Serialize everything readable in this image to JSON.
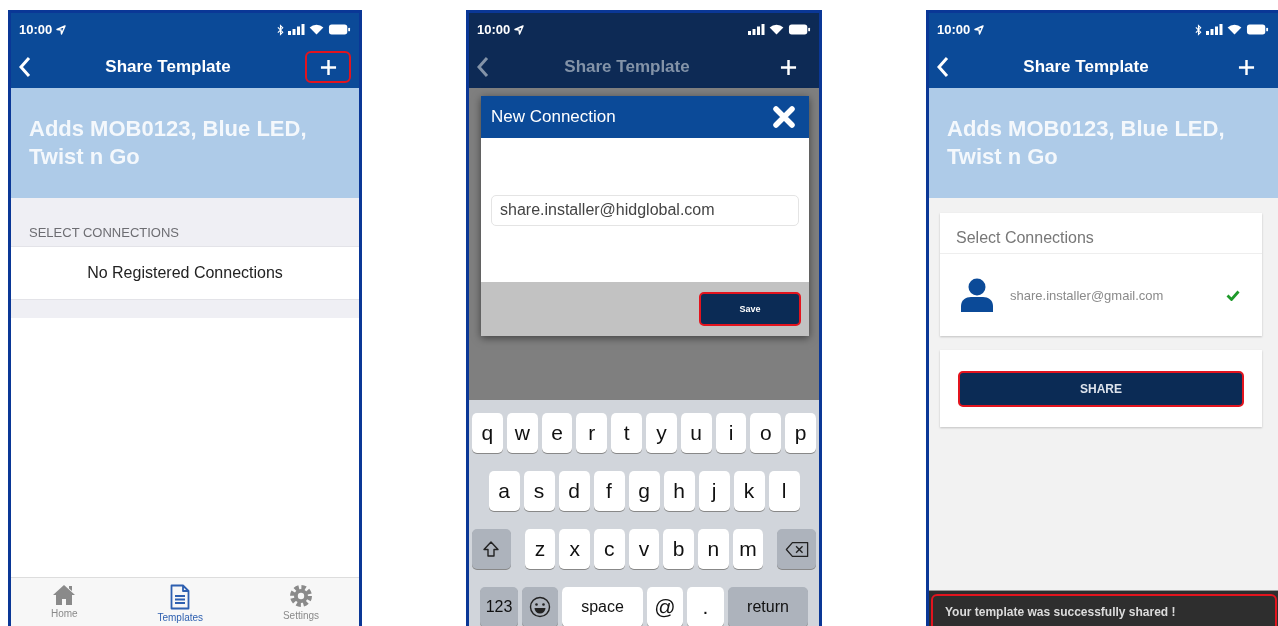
{
  "phones": [
    {
      "kind": "empty",
      "status_bar": {
        "time": "10:00",
        "bluetooth": true
      },
      "nav": {
        "title": "Share Template",
        "add_highlighted": true
      },
      "template_name": "Adds MOB0123, Blue LED, Twist n Go",
      "section_label": "SELECT CONNECTIONS",
      "empty_message": "No Registered Connections",
      "tabs": [
        {
          "kind": "home",
          "label": "Home",
          "selected": false
        },
        {
          "kind": "templates",
          "label": "Templates",
          "selected": true
        },
        {
          "kind": "settings",
          "label": "Settings",
          "selected": false
        }
      ]
    },
    {
      "kind": "dialog",
      "status_bar": {
        "time": "10:00",
        "bluetooth": false
      },
      "nav": {
        "title": "Share Template",
        "add_highlighted": false
      },
      "dialog": {
        "title": "New Connection",
        "value": "share.installer@hidglobal.com",
        "save_label": "Save",
        "save_highlighted": true
      },
      "keyboard": [
        [
          {
            "kind": "letter",
            "label": "q"
          },
          {
            "kind": "letter",
            "label": "w"
          },
          {
            "kind": "letter",
            "label": "e"
          },
          {
            "kind": "letter",
            "label": "r"
          },
          {
            "kind": "letter",
            "label": "t"
          },
          {
            "kind": "letter",
            "label": "y"
          },
          {
            "kind": "letter",
            "label": "u"
          },
          {
            "kind": "letter",
            "label": "i"
          },
          {
            "kind": "letter",
            "label": "o"
          },
          {
            "kind": "letter",
            "label": "p"
          }
        ],
        [
          {
            "kind": "letter",
            "label": "a"
          },
          {
            "kind": "letter",
            "label": "s"
          },
          {
            "kind": "letter",
            "label": "d"
          },
          {
            "kind": "letter",
            "label": "f"
          },
          {
            "kind": "letter",
            "label": "g"
          },
          {
            "kind": "letter",
            "label": "h"
          },
          {
            "kind": "letter",
            "label": "j"
          },
          {
            "kind": "letter",
            "label": "k"
          },
          {
            "kind": "letter",
            "label": "l"
          }
        ],
        [
          {
            "kind": "shift"
          },
          {
            "kind": "letter",
            "label": "z"
          },
          {
            "kind": "letter",
            "label": "x"
          },
          {
            "kind": "letter",
            "label": "c"
          },
          {
            "kind": "letter",
            "label": "v"
          },
          {
            "kind": "letter",
            "label": "b"
          },
          {
            "kind": "letter",
            "label": "n"
          },
          {
            "kind": "letter",
            "label": "m"
          },
          {
            "kind": "backspace"
          }
        ],
        [
          {
            "kind": "mode",
            "label": "123"
          },
          {
            "kind": "emoji"
          },
          {
            "kind": "space",
            "label": "space"
          },
          {
            "kind": "symbol",
            "label": "@"
          },
          {
            "kind": "dot",
            "label": "."
          },
          {
            "kind": "return",
            "label": "return"
          }
        ]
      ]
    },
    {
      "kind": "shared",
      "status_bar": {
        "time": "10:00",
        "bluetooth": true
      },
      "nav": {
        "title": "Share Template",
        "add_highlighted": false
      },
      "template_name": "Adds MOB0123, Blue LED, Twist n Go",
      "card_title": "Select Connections",
      "connections": [
        {
          "email": "share.installer@gmail.com",
          "checked": true
        }
      ],
      "share_button": {
        "label": "SHARE",
        "highlighted": true
      },
      "toast": {
        "text": "Your template was successfully shared !",
        "highlighted": true
      }
    }
  ]
}
